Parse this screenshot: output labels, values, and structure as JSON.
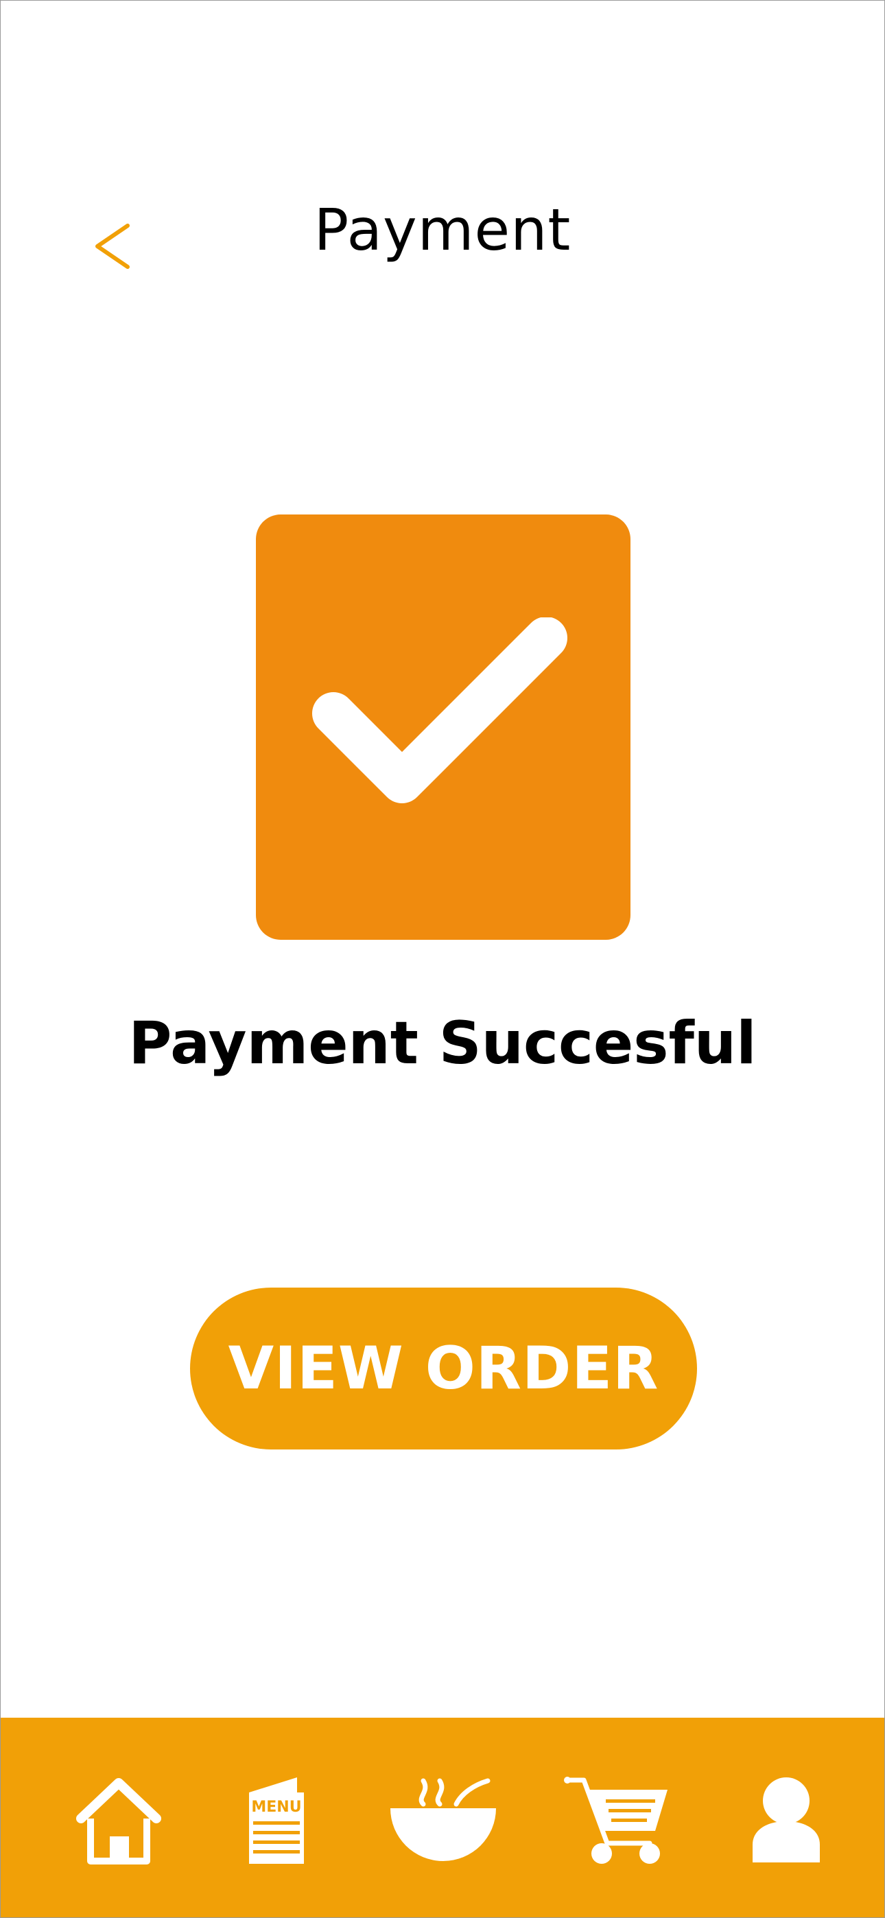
{
  "colors": {
    "accent": "#f1a007",
    "card": "#f08b0e",
    "text": "#000000",
    "white": "#ffffff"
  },
  "header": {
    "title": "Payment",
    "back_icon": "chevron-left-icon"
  },
  "status": {
    "icon": "checkmark-icon",
    "message": "Payment Succesful"
  },
  "actions": {
    "view_order_label": "VIEW ORDER"
  },
  "bottom_nav": {
    "items": [
      {
        "icon": "home-icon"
      },
      {
        "icon": "menu-icon",
        "label": "MENU"
      },
      {
        "icon": "food-bowl-icon"
      },
      {
        "icon": "cart-icon"
      },
      {
        "icon": "profile-icon"
      }
    ]
  }
}
